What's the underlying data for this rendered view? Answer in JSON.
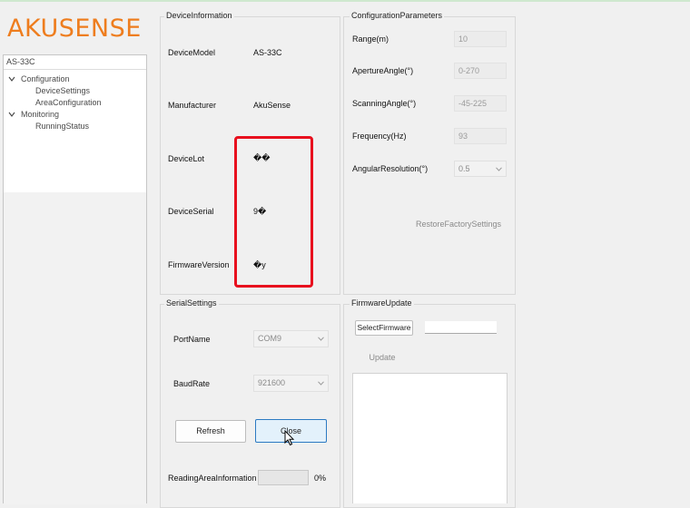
{
  "brand": {
    "logo_text": "AKUSENSE",
    "logo_color": "#ee7d1e"
  },
  "tree": {
    "root": "AS-33C",
    "groups": [
      {
        "label": "Configuration",
        "children": [
          "DeviceSettings",
          "AreaConfiguration"
        ]
      },
      {
        "label": "Monitoring",
        "children": [
          "RunningStatus"
        ]
      }
    ]
  },
  "device_info": {
    "title": "DeviceInformation",
    "rows": [
      {
        "label": "DeviceModel",
        "value": "AS-33C"
      },
      {
        "label": "Manufacturer",
        "value": "AkuSense"
      },
      {
        "label": "DeviceLot",
        "value": "��"
      },
      {
        "label": "DeviceSerial",
        "value": "9�"
      },
      {
        "label": "FirmwareVersion",
        "value": "�y"
      }
    ],
    "highlight_color": "#e8101e"
  },
  "config": {
    "title": "ConfigurationParameters",
    "range": {
      "label": "Range(m)",
      "value": "10"
    },
    "aperture": {
      "label": "ApertureAngle(°)",
      "value": "0-270"
    },
    "scanning": {
      "label": "ScanningAngle(°)",
      "value": "-45-225"
    },
    "frequency": {
      "label": "Frequency(Hz)",
      "value": "93"
    },
    "angular": {
      "label": "AngularResolution(°)",
      "value": "0.5"
    },
    "restore_label": "RestoreFactorySettings"
  },
  "serial": {
    "title": "SerialSettings",
    "port_label": "PortName",
    "port_value": "COM9",
    "baud_label": "BaudRate",
    "baud_value": "921600",
    "refresh_label": "Refresh",
    "close_label": "Close",
    "reading_label": "ReadingAreaInformation",
    "progress_text": "0%",
    "progress": 0
  },
  "firmware": {
    "title": "FirmwareUpdate",
    "select_label": "SelectFirmware",
    "file_value": "",
    "update_label": "Update"
  },
  "colors": {
    "accent_border": "#2c7ac2",
    "button_hover": "#e3f1fb"
  }
}
